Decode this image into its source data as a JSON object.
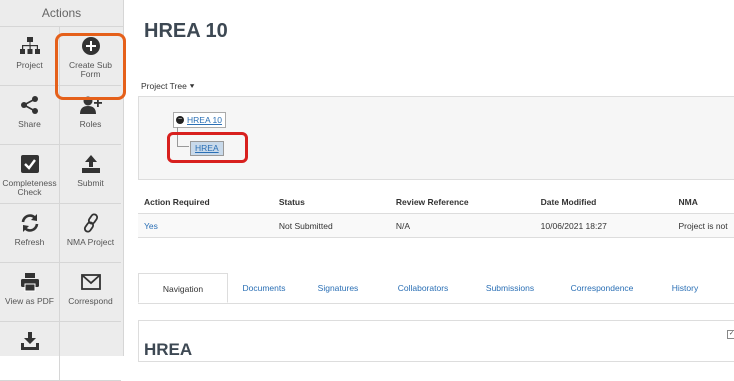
{
  "sidebar": {
    "title": "Actions",
    "items": [
      {
        "label": "Project",
        "icon": "hierarchy-icon"
      },
      {
        "label": "Create Sub Form",
        "icon": "plus-circle-icon"
      },
      {
        "label": "Share",
        "icon": "share-icon"
      },
      {
        "label": "Roles",
        "icon": "add-user-icon"
      },
      {
        "label": "Completeness Check",
        "icon": "checkbox-icon"
      },
      {
        "label": "Submit",
        "icon": "upload-icon"
      },
      {
        "label": "Refresh",
        "icon": "refresh-icon"
      },
      {
        "label": "NMA Project",
        "icon": "link-icon"
      },
      {
        "label": "View as PDF",
        "icon": "printer-icon"
      },
      {
        "label": "Correspond",
        "icon": "envelope-icon"
      },
      {
        "label": "",
        "icon": "download-icon"
      },
      {
        "label": "",
        "icon": ""
      }
    ]
  },
  "page_title": "HREA 10",
  "project_tree": {
    "label": "Project Tree",
    "root": "HREA 10",
    "child": "HREA"
  },
  "status_table": {
    "headers": [
      "Action Required",
      "Status",
      "Review Reference",
      "Date Modified",
      "NMA"
    ],
    "row": [
      "Yes",
      "Not Submitted",
      "N/A",
      "10/06/2021 18:27",
      "Project is not"
    ]
  },
  "tabs": [
    "Navigation",
    "Documents",
    "Signatures",
    "Collaborators",
    "Submissions",
    "Correspondence",
    "History"
  ],
  "section_title": "HREA",
  "colors": {
    "highlight_orange": "#e5601a",
    "highlight_red": "#d8201e",
    "link": "#2a6fb5"
  }
}
